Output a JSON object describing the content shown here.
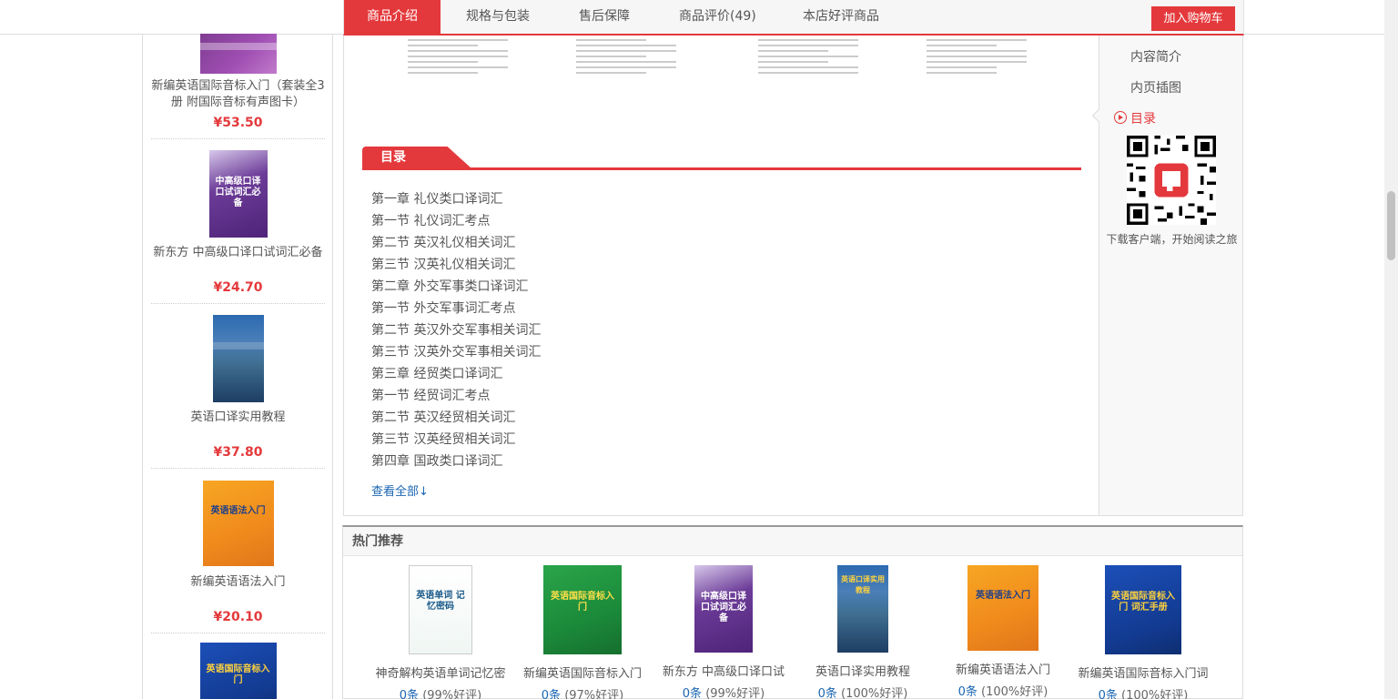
{
  "tabs": [
    {
      "label": "商品介绍",
      "active": true
    },
    {
      "label": "规格与包装",
      "active": false
    },
    {
      "label": "售后保障",
      "active": false
    },
    {
      "label": "商品评价(49)",
      "active": false
    },
    {
      "label": "本店好评商品",
      "active": false
    }
  ],
  "cart_button": "加入购物车",
  "sidebar": {
    "items": [
      {
        "name": "新编英语国际音标入门（套装全3册 附国际音标有声图卡）",
        "price": "¥53.50",
        "cover_icon": "book-cover-purple"
      },
      {
        "name": "新东方 中高级口译口试词汇必备",
        "price": "¥24.70",
        "cover_icon": "book-cover-violet",
        "cover_text": "中高级口译 口试词汇必备"
      },
      {
        "name": "英语口译实用教程",
        "price": "¥37.80",
        "cover_icon": "book-cover-blue"
      },
      {
        "name": "新编英语语法入门",
        "price": "¥20.10",
        "cover_icon": "book-cover-orange",
        "cover_text": "英语语法入门"
      },
      {
        "name": "",
        "price": "",
        "cover_icon": "book-cover-royal",
        "cover_text": "英语国际音标入门"
      }
    ]
  },
  "section": {
    "title": "目录",
    "toc": [
      "第一章 礼仪类口译词汇",
      "第一节 礼仪词汇考点",
      "第二节 英汉礼仪相关词汇",
      "第三节 汉英礼仪相关词汇",
      "第二章 外交军事类口译词汇",
      "第一节 外交军事词汇考点",
      "第二节 英汉外交军事相关词汇",
      "第三节 汉英外交军事相关词汇",
      "第三章 经贸类口译词汇",
      "第一节 经贸词汇考点",
      "第二节 英汉经贸相关词汇",
      "第三节 汉英经贸相关词汇",
      "第四章 国政类口译词汇"
    ],
    "see_all": "查看全部↓"
  },
  "right_nav": {
    "items": [
      {
        "label": "内容简介",
        "active": false
      },
      {
        "label": "内页插图",
        "active": false
      },
      {
        "label": "目录",
        "active": true
      }
    ],
    "qr_caption": "下载客户端，开始阅读之旅"
  },
  "hot": {
    "title": "热门推荐",
    "items": [
      {
        "name": "神奇解构英语单词记忆密",
        "count": "0条",
        "rate": "(99%好评)",
        "cover_icon": "book-cover-white",
        "cover_text": "英语单词 记忆密码"
      },
      {
        "name": "新编英语国际音标入门",
        "count": "0条",
        "rate": "(97%好评)",
        "cover_icon": "book-cover-green",
        "cover_text": "英语国际音标入门"
      },
      {
        "name": "新东方 中高级口译口试",
        "count": "0条",
        "rate": "(99%好评)",
        "cover_icon": "book-cover-violet",
        "cover_text": "中高级口译 口试词汇必备"
      },
      {
        "name": "英语口译实用教程",
        "count": "0条",
        "rate": "(100%好评)",
        "cover_icon": "book-cover-blue",
        "cover_text": "英语口译实用教程"
      },
      {
        "name": "新编英语语法入门",
        "count": "0条",
        "rate": "(100%好评)",
        "cover_icon": "book-cover-orange",
        "cover_text": "英语语法入门"
      },
      {
        "name": "新编英语国际音标入门词",
        "count": "0条",
        "rate": "(100%好评)",
        "cover_icon": "book-cover-royal",
        "cover_text": "英语国际音标入门 词汇手册"
      }
    ]
  },
  "colors": {
    "accent": "#e4393c",
    "link": "#1a66b3"
  }
}
